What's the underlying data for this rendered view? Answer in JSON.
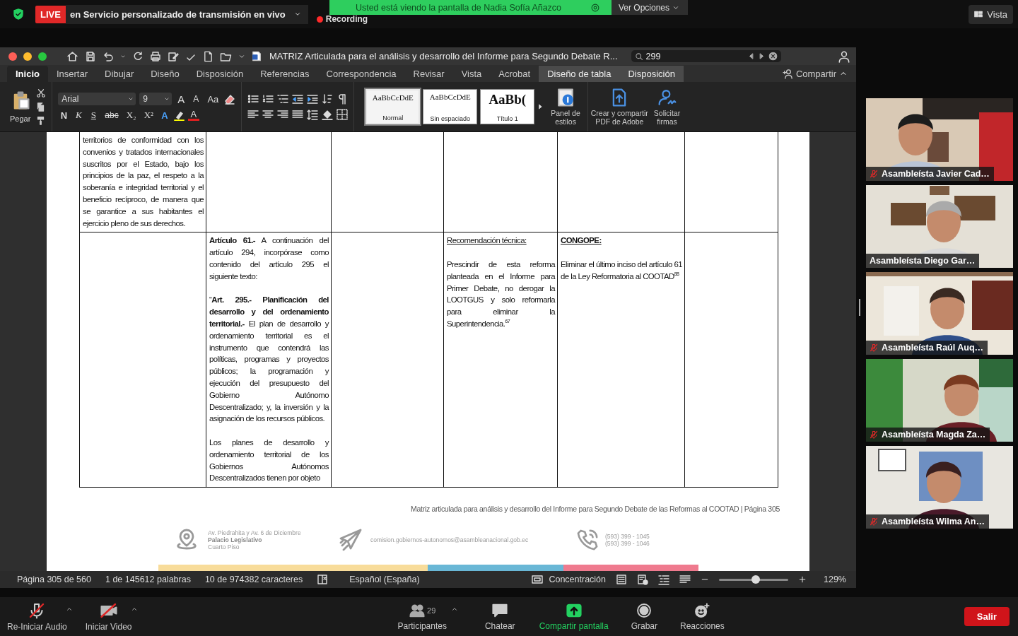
{
  "meeting_bar": {
    "live_badge": "LIVE",
    "stream_title": "en Servicio personalizado de transmisión en vivo",
    "recording": "Recording",
    "share_banner": "Usted está viendo la pantalla de Nadia Sofía Añazco",
    "view_options": "Ver Opciones",
    "view_button": "Vista"
  },
  "word": {
    "title": "MATRIZ Articulada para el análisis y desarrollo del Informe para Segundo Debate R...",
    "search": {
      "value": "299"
    },
    "share_button": "Compartir",
    "tabs": [
      {
        "label": "Inicio",
        "selected": true,
        "contextual": false
      },
      {
        "label": "Insertar",
        "selected": false,
        "contextual": false
      },
      {
        "label": "Dibujar",
        "selected": false,
        "contextual": false
      },
      {
        "label": "Diseño",
        "selected": false,
        "contextual": false
      },
      {
        "label": "Disposición",
        "selected": false,
        "contextual": false
      },
      {
        "label": "Referencias",
        "selected": false,
        "contextual": false
      },
      {
        "label": "Correspondencia",
        "selected": false,
        "contextual": false
      },
      {
        "label": "Revisar",
        "selected": false,
        "contextual": false
      },
      {
        "label": "Vista",
        "selected": false,
        "contextual": false
      },
      {
        "label": "Acrobat",
        "selected": false,
        "contextual": false
      },
      {
        "label": "Diseño de tabla",
        "selected": false,
        "contextual": true
      },
      {
        "label": "Disposición",
        "selected": false,
        "contextual": true
      }
    ],
    "ribbon": {
      "paste": "Pegar",
      "font": "Arial",
      "size": "9",
      "grow_buttons": [
        "A",
        "A"
      ],
      "case_button": "Aa",
      "format_buttons": [
        "N",
        "K",
        "S",
        "abc",
        "X₂",
        "X²"
      ],
      "effects_button": "A",
      "color_button": "A",
      "styles": [
        {
          "preview": "AaBbCcDdE",
          "label": "Normal",
          "selected": true,
          "kind": "normal"
        },
        {
          "preview": "AaBbCcDdE",
          "label": "Sin espaciado",
          "selected": false,
          "kind": "normal"
        },
        {
          "preview": "AaBb(",
          "label": "Título 1",
          "selected": false,
          "kind": "heading"
        }
      ],
      "styles_pane": "Panel de estilos",
      "pdf": "Crear y compartir PDF de Adobe",
      "sign": "Solicitar firmas"
    },
    "table": {
      "rows": [
        {
          "column_1": [
            {
              "kind": "body",
              "text": "territorios de conformidad con los convenios y tratados internacionales suscritos por el Estado, bajo los principios de la paz, el respeto a la soberanía e integridad territorial y el beneficio recíproco, de manera que se garantice a sus habitantes el ejercicio pleno de sus derechos."
            }
          ]
        },
        {
          "column_2": [
            {
              "kind": "body",
              "text": "**Artículo 61.-** A continuación del artículo 294, incorpórase como contenido del artículo 295 el siguiente texto:"
            },
            {
              "kind": "body",
              "text": "“**Art. 295.- Planificación del desarrollo y del ordenamiento territorial.-** El plan de desarrollo y ordenamiento territorial es el instrumento que contendrá las políticas, programas y proyectos públicos; la programación y ejecución del presupuesto del Gobierno Autónomo Descentralizado; y, la inversión y la asignación de los recursos públicos."
            },
            {
              "kind": "body",
              "text": "Los planes de desarrollo y ordenamiento territorial de los Gobiernos Autónomos Descentralizados tienen por objeto"
            }
          ],
          "column_4": [
            {
              "kind": "label",
              "text": "Recomendación técnica:"
            },
            {
              "kind": "body",
              "text": "Prescindir de esta reforma planteada en el Informe para Primer Debate, no derogar la LOOTGUS y solo reformarla para eliminar la Superintendencia.$^{67}$"
            }
          ],
          "column_5": [
            {
              "kind": "heading",
              "text": "CONGOPE:"
            },
            {
              "kind": "body",
              "text": "Eliminar el último inciso del artículo 61 de la Ley Reformatoria al COOTAD$^{88}$"
            }
          ]
        }
      ]
    },
    "footer": {
      "caption": "Matriz articulada para análisis y desarrollo del Informe para Segundo Debate de las Reformas al COOTAD | Página 305",
      "address": [
        "Av. Piedrahita y Av. 6 de Diciembre",
        "Palacio Legislativo",
        "Cuarto Piso"
      ],
      "email": "comision.gobiernos-autonomos@asambleanacional.gob.ec",
      "phones": [
        "(593) 399 - 1045",
        "(593) 399 - 1046"
      ]
    },
    "status_bar": {
      "page": "Página 305 de 560",
      "words": "1 de 145612 palabras",
      "chars": "10 de 974382 caracteres",
      "language": "Español (España)",
      "focus": "Concentración",
      "zoom": "129%",
      "level": 0.53
    }
  },
  "participants": [
    {
      "name": "Asambleísta Javier Cad…",
      "muted": true
    },
    {
      "name": "Asambleísta Diego Gar…",
      "muted": false
    },
    {
      "name": "Asambleísta Raúl Auq…",
      "muted": true
    },
    {
      "name": "Asambleísta Magda Za…",
      "muted": true
    },
    {
      "name": "Asambleísta Wilma An…",
      "muted": true
    }
  ],
  "toolbar": {
    "audio": "Re-Iniciar Audio",
    "video": "Iniciar Video",
    "participant_count": "29",
    "participants": "Participantes",
    "chat": "Chatear",
    "share": "Compartir pantalla",
    "record": "Grabar",
    "reactions": "Reacciones",
    "leave": "Salir"
  }
}
